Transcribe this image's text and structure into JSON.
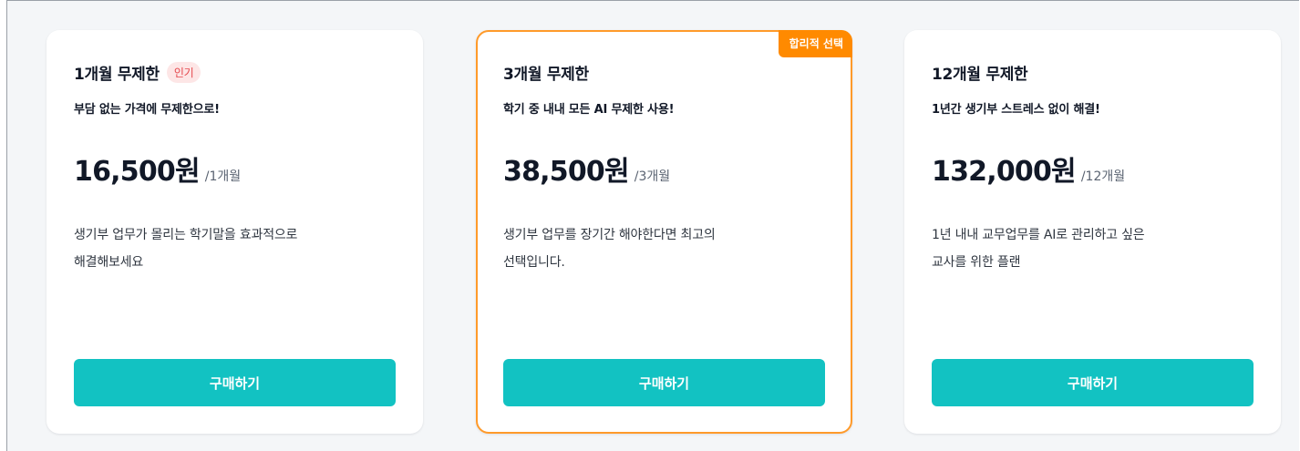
{
  "plans": [
    {
      "title": "1개월 무제한",
      "badge": "인기",
      "subtitle": "부담 없는 가격에 무제한으로!",
      "price": "16,500원",
      "period": "/1개월",
      "description": [
        "생기부 업무가 몰리는 학기말을 효과적으로",
        "해결해보세요"
      ],
      "button_label": "구매하기"
    },
    {
      "title": "3개월 무제한",
      "ribbon": "합리적 선택",
      "subtitle": "학기 중 내내 모든 AI 무제한 사용!",
      "price": "38,500원",
      "period": "/3개월",
      "description": [
        "생기부 업무를 장기간 해야한다면 최고의",
        "선택입니다."
      ],
      "button_label": "구매하기"
    },
    {
      "title": "12개월 무제한",
      "subtitle": "1년간 생기부 스트레스 없이 해결!",
      "price": "132,000원",
      "period": "/12개월",
      "description": [
        "1년 내내 교무업무를 AI로 관리하고 싶은",
        "교사를 위한 플랜"
      ],
      "button_label": "구매하기"
    }
  ],
  "colors": {
    "accent": "#12c2c2",
    "highlight_border": "#ff9a2a",
    "ribbon": "#ff8a00",
    "badge_bg": "#fde6e6",
    "badge_text": "#e5484d"
  }
}
